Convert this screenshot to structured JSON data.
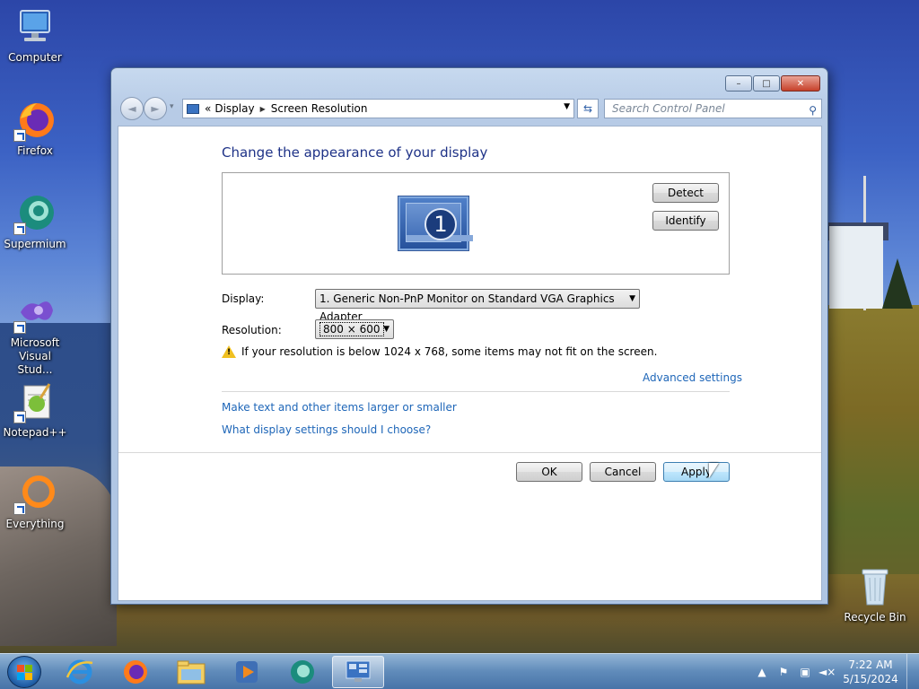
{
  "desktop": {
    "icons": [
      {
        "label": "Computer",
        "icon": "computer-icon"
      },
      {
        "label": "Firefox",
        "icon": "firefox-icon"
      },
      {
        "label": "Supermium",
        "icon": "supermium-icon"
      },
      {
        "label": "Microsoft Visual Stud...",
        "icon": "visual-studio-icon"
      },
      {
        "label": "Notepad++",
        "icon": "notepadpp-icon"
      },
      {
        "label": "Everything",
        "icon": "everything-icon"
      }
    ],
    "recycle_bin": {
      "label": "Recycle Bin",
      "icon": "recycle-bin-icon"
    }
  },
  "window": {
    "controls": {
      "minimize": "–",
      "maximize": "□",
      "close": "✕"
    },
    "nav": {
      "back": "◄",
      "forward": "►",
      "history": "▾"
    },
    "address": {
      "overflow": "«",
      "crumbs": [
        "Display",
        "Screen Resolution"
      ]
    },
    "search_placeholder": "Search Control Panel",
    "heading": "Change the appearance of your display",
    "monitor_number": "1",
    "detect_label": "Detect",
    "identify_label": "Identify",
    "display_label": "Display:",
    "display_value": "1. Generic Non-PnP Monitor on Standard VGA Graphics Adapter",
    "resolution_label": "Resolution:",
    "resolution_value": "800 × 600",
    "warning_text": "If your resolution is below 1024 x 768, some items may not fit on the screen.",
    "advanced_settings": "Advanced settings",
    "links": [
      "Make text and other items larger or smaller",
      "What display settings should I choose?"
    ],
    "ok_label": "OK",
    "cancel_label": "Cancel",
    "apply_label": "Apply"
  },
  "taskbar": {
    "items": [
      "internet-explorer-icon",
      "firefox-icon",
      "file-explorer-icon",
      "media-player-icon",
      "supermium-icon",
      "control-panel-icon"
    ],
    "active_item": "control-panel-icon",
    "time": "7:22 AM",
    "date": "5/15/2024"
  },
  "colors": {
    "heading": "#1e3287",
    "link": "#1e66b8",
    "warning": "#f0c020"
  }
}
